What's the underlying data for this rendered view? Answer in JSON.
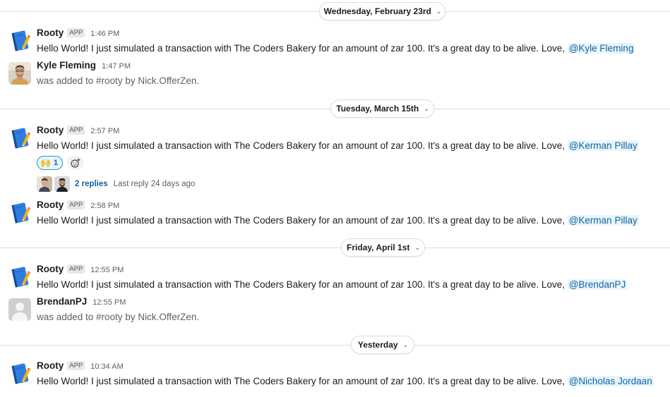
{
  "dividers": [
    {
      "label": "Wednesday, February 23rd"
    },
    {
      "label": "Tuesday, March 15th"
    },
    {
      "label": "Friday, April 1st"
    },
    {
      "label": "Yesterday"
    }
  ],
  "app_badge": "APP",
  "messages": [
    {
      "name": "Rooty",
      "time": "1:46 PM",
      "text": "Hello World! I just simulated a transaction with The Coders Bakery for an amount of zar 100. It's a great day to be alive. Love, ",
      "mention": "@Kyle Fleming"
    },
    {
      "name": "Kyle Fleming",
      "time": "1:47 PM",
      "text": "was added to #rooty by Nick.OfferZen."
    },
    {
      "name": "Rooty",
      "time": "2:57 PM",
      "text": "Hello World! I just simulated a transaction with The Coders Bakery for an amount of zar 100. It's a great day to be alive. Love, ",
      "mention": "@Kerman Pillay"
    },
    {
      "name": "Rooty",
      "time": "2:58 PM",
      "text": "Hello World! I just simulated a transaction with The Coders Bakery for an amount of zar 100. It's a great day to be alive. Love, ",
      "mention": "@Kerman Pillay"
    },
    {
      "name": "Rooty",
      "time": "12:55 PM",
      "text": "Hello World! I just simulated a transaction with The Coders Bakery for an amount of zar 100. It's a great day to be alive. Love, ",
      "mention": "@BrendanPJ"
    },
    {
      "name": "BrendanPJ",
      "time": "12:55 PM",
      "text": "was added to #rooty by Nick.OfferZen."
    },
    {
      "name": "Rooty",
      "time": "10:34 AM",
      "text": "Hello World! I just simulated a transaction with The Coders Bakery for an amount of zar 100. It's a great day to be alive. Love, ",
      "mention": "@Nicholas Jordaan"
    }
  ],
  "reaction": {
    "emoji": "🙌",
    "count": "1"
  },
  "thread": {
    "replies": "2 replies",
    "last_reply": "Last reply 24 days ago"
  },
  "colors": {
    "link": "#1264a3",
    "mention_bg": "#e8f5fa",
    "divider": "#dddddd"
  }
}
